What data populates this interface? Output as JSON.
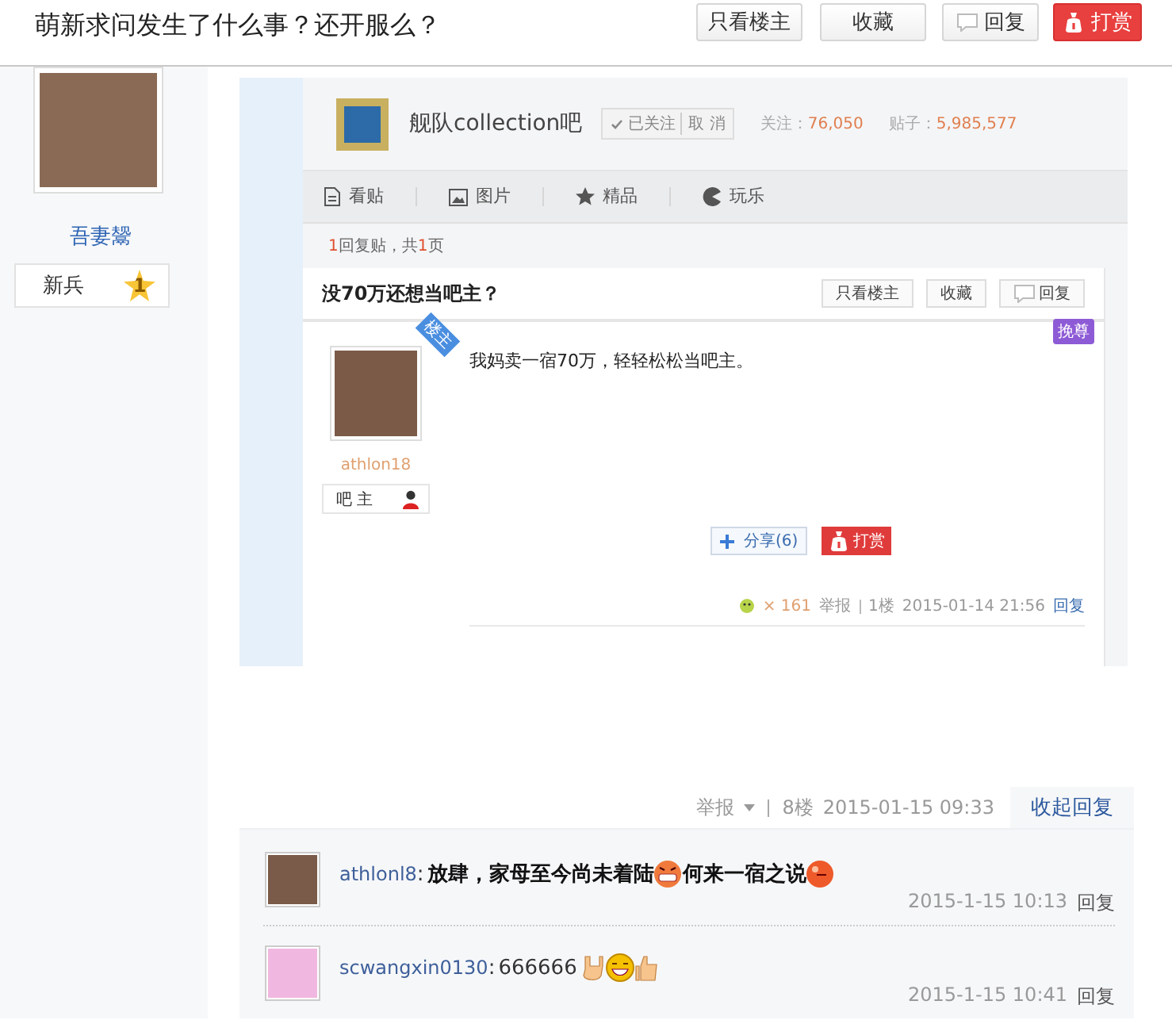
{
  "header": {
    "title": "萌新求问发生了什么事？还开服么？",
    "buttons": [
      {
        "label": "只看楼主",
        "kind": "plain"
      },
      {
        "label": "收藏",
        "kind": "plain"
      },
      {
        "label": "回复",
        "kind": "reply"
      },
      {
        "label": "打赏",
        "kind": "reward"
      }
    ]
  },
  "author": {
    "name": "吾妻鬶",
    "rank": "新兵",
    "rank_badge": "1"
  },
  "embedded_screenshot": {
    "forum": {
      "name": "舰队collection吧",
      "followed": "已关注",
      "unfollow": "取 消",
      "stats": [
        {
          "label": "关注：",
          "value": "76,050"
        },
        {
          "label": "贴子：",
          "value": "5,985,577"
        }
      ]
    },
    "nav": [
      {
        "label": "看贴",
        "kind": "doc"
      },
      {
        "label": "图片",
        "kind": "image"
      },
      {
        "label": "精品",
        "kind": "star"
      },
      {
        "label": "玩乐",
        "kind": "game"
      }
    ],
    "page_info": {
      "count": "1",
      "text_a": "回复贴，共",
      "pages": "1",
      "text_b": "页"
    },
    "post": {
      "title": "没70万还想当吧主？",
      "buttons": [
        {
          "label": "只看楼主",
          "kind": "plain"
        },
        {
          "label": "收藏",
          "kind": "plain"
        },
        {
          "label": "回复",
          "kind": "reply"
        }
      ],
      "promote": "挽尊",
      "corner_tag": "楼主",
      "author": "athlon18",
      "role": "吧 主",
      "content": "我妈卖一宿70万，轻轻松松当吧主。",
      "share": "分享(6)",
      "reward": "打赏",
      "likes": "× 161",
      "report": "举报",
      "floor": "1楼",
      "time": "2015-01-14 21:56",
      "reply": "回复"
    }
  },
  "floor_meta": {
    "report": "举报",
    "floor": "8楼",
    "time": "2015-01-15 09:33",
    "toggle": "收起回复"
  },
  "replies": [
    {
      "user": "athlonl8",
      "sep": ":",
      "segments": [
        {
          "kind": "text",
          "text": "放肆，家母至今尚未着陆"
        },
        {
          "kind": "grin"
        },
        {
          "kind": "text",
          "text": "何来一宿之说"
        },
        {
          "kind": "ball"
        }
      ],
      "time": "2015-1-15 10:13",
      "reply": "回复"
    },
    {
      "user": "scwangxin0130",
      "sep": ":",
      "segments": [
        {
          "kind": "plain",
          "text": "666666"
        },
        {
          "kind": "rock"
        },
        {
          "kind": "smile"
        },
        {
          "kind": "thumb"
        }
      ],
      "time": "2015-1-15 10:41",
      "reply": "回复"
    }
  ]
}
